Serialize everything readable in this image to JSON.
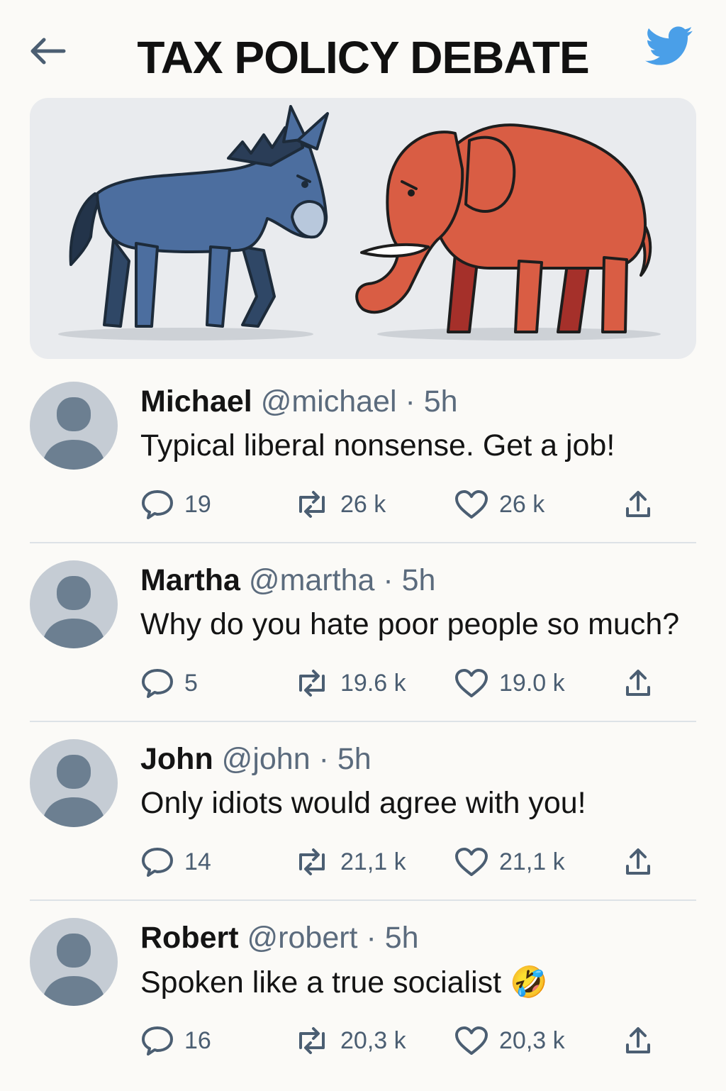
{
  "header": {
    "title": "TAX POLICY DEBATE",
    "back_icon": "back-arrow-icon",
    "brand_icon": "twitter-bird-icon",
    "brand_color": "#4a9fe8"
  },
  "hero": {
    "image": "donkey-vs-elephant-illustration",
    "colors": {
      "donkey": "#4c6e9f",
      "elephant": "#d95d44",
      "background": "#e9ebee"
    }
  },
  "tweets": [
    {
      "name": "Michael",
      "handle": "@michael",
      "time": "5h",
      "text": "Typical liberal nonsense. Get a job!",
      "replies": "19",
      "retweets": "26 k",
      "likes": "26 k"
    },
    {
      "name": "Martha",
      "handle": "@martha",
      "time": "5h",
      "text": "Why do you hate poor people so much?",
      "replies": "5",
      "retweets": "19.6 k",
      "likes": "19.0 k"
    },
    {
      "name": "John",
      "handle": "@john",
      "time": "5h",
      "text": "Only idiots would agree with you!",
      "replies": "14",
      "retweets": "21,1 k",
      "likes": "21,1 k"
    },
    {
      "name": "Robert",
      "handle": "@robert",
      "time": "5h",
      "text": "Spoken like a true socialist",
      "emoji": "🤣",
      "replies": "16",
      "retweets": "20,3 k",
      "likes": "20,3 k"
    }
  ],
  "icons": {
    "reply": "reply-bubble-icon",
    "retweet": "retweet-icon",
    "like": "heart-icon",
    "share": "share-icon"
  },
  "colors": {
    "icon": "#4b5e72",
    "handle": "#5b6b7d",
    "avatar_bg": "#c5ccd4",
    "avatar_fg": "#6c7f91",
    "divider": "#dde2e7"
  }
}
